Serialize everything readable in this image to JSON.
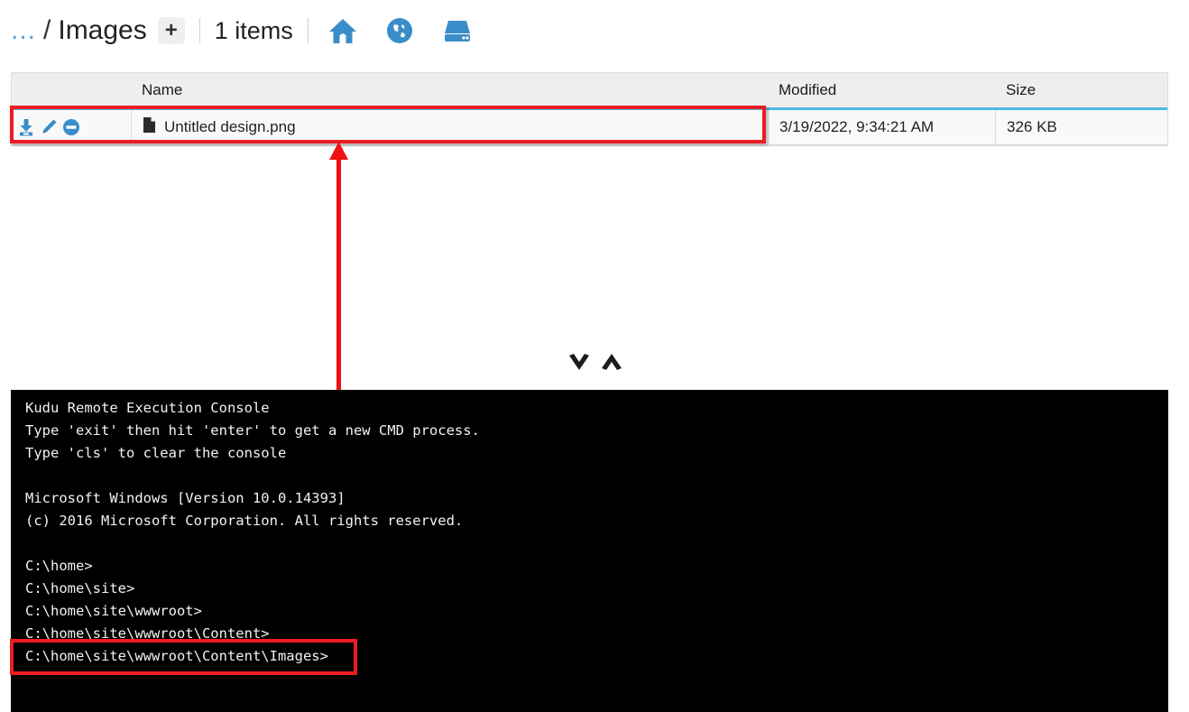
{
  "topbar": {
    "breadcrumb_parent": "...",
    "breadcrumb_separator": "/",
    "breadcrumb_current": "Images",
    "add_label": "+",
    "items_count": "1 items",
    "icons": [
      {
        "name": "home-icon",
        "title": "Home"
      },
      {
        "name": "globe-icon",
        "title": "Site"
      },
      {
        "name": "hard-drive-icon",
        "title": "Drive"
      }
    ]
  },
  "table": {
    "columns": [
      "",
      "Name",
      "Modified",
      "Size"
    ],
    "headers": {
      "actions": "",
      "name": "Name",
      "modified": "Modified",
      "size": "Size"
    },
    "accent_color": "#4fb9e4",
    "rows": [
      {
        "actions": [
          "download-icon",
          "edit-icon",
          "delete-icon"
        ],
        "file_icon": "file-icon",
        "name": "Untitled design.png",
        "modified": "3/19/2022, 9:34:21 AM",
        "size": "326 KB"
      }
    ]
  },
  "annotations": {
    "highlight_color": "#ec1c24",
    "arrow": "red-up-arrow",
    "boxes": [
      "file-row-highlight",
      "console-prompt-highlight"
    ]
  },
  "toggles": {
    "collapse_icon": "chevron-down-icon",
    "expand_icon": "chevron-up-icon"
  },
  "console": {
    "text": "Kudu Remote Execution Console\nType 'exit' then hit 'enter' to get a new CMD process.\nType 'cls' to clear the console\n\nMicrosoft Windows [Version 10.0.14393]\n(c) 2016 Microsoft Corporation. All rights reserved.\n\nC:\\home>\nC:\\home\\site>\nC:\\home\\site\\wwwroot>\nC:\\home\\site\\wwwroot\\Content>\nC:\\home\\site\\wwwroot\\Content\\Images>",
    "lines": [
      "Kudu Remote Execution Console",
      "Type 'exit' then hit 'enter' to get a new CMD process.",
      "Type 'cls' to clear the console",
      "",
      "Microsoft Windows [Version 10.0.14393]",
      "(c) 2016 Microsoft Corporation. All rights reserved.",
      "",
      "C:\\home>",
      "C:\\home\\site>",
      "C:\\home\\site\\wwwroot>",
      "C:\\home\\site\\wwwroot\\Content>",
      "C:\\home\\site\\wwwroot\\Content\\Images>"
    ],
    "current_prompt": "C:\\home\\site\\wwwroot\\Content\\Images>",
    "background": "#000000",
    "foreground": "#f2f2f2"
  }
}
